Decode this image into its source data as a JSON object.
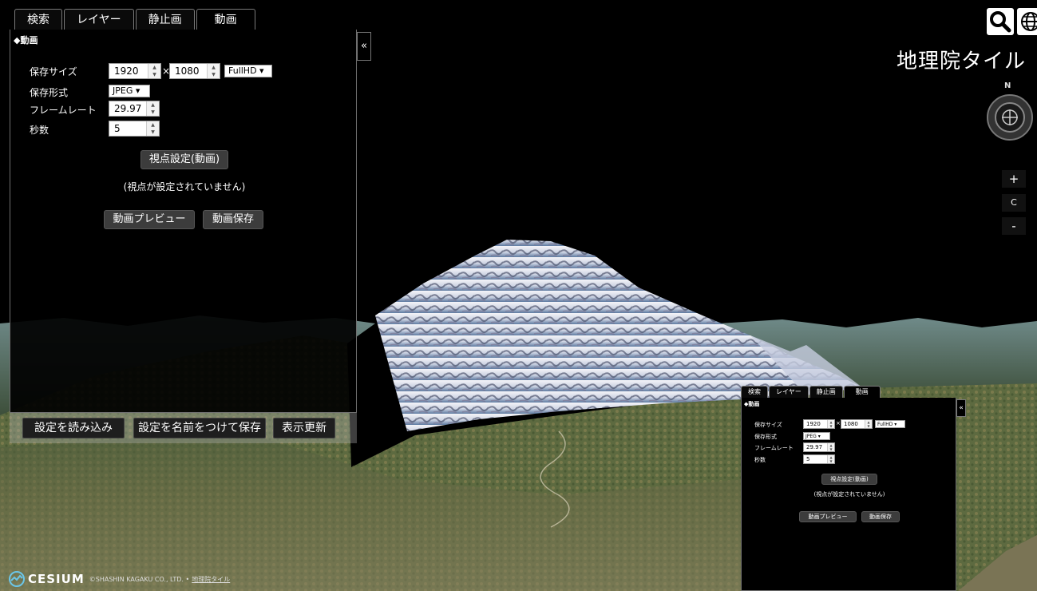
{
  "main": {
    "tabs": [
      "検索",
      "レイヤー",
      "静止画",
      "動画"
    ],
    "active_tab": 3,
    "section": "◆動画",
    "collapse_label": "«",
    "save_size": {
      "label": "保存サイズ",
      "width": "1920",
      "times": "×",
      "height": "1080",
      "preset": "FullHD ▾"
    },
    "format": {
      "label": "保存形式",
      "value": "JPEG ▾"
    },
    "frame_rate": {
      "label": "フレームレート",
      "value": "29.97"
    },
    "seconds": {
      "label": "秒数",
      "value": "5"
    },
    "viewpoint_button": "視点設定(動画)",
    "viewpoint_note": "(視点が設定されていません)",
    "preview_button": "動画プレビュー",
    "save_button": "動画保存",
    "footer": {
      "load": "設定を読み込み",
      "save_as": "設定を名前をつけて保存",
      "refresh": "表示更新"
    }
  },
  "map": {
    "layer_name": "地理院タイル",
    "compass_n": "N",
    "zoom_in": "+",
    "reset": "C",
    "zoom_out": "-",
    "credit_logo": "CESIUM",
    "credit_text": "©SHASHIN KAGAKU CO., LTD. •",
    "credit_link": "地理院タイル",
    "icons": {
      "search": "search-icon",
      "globe": "globe-icon"
    }
  }
}
